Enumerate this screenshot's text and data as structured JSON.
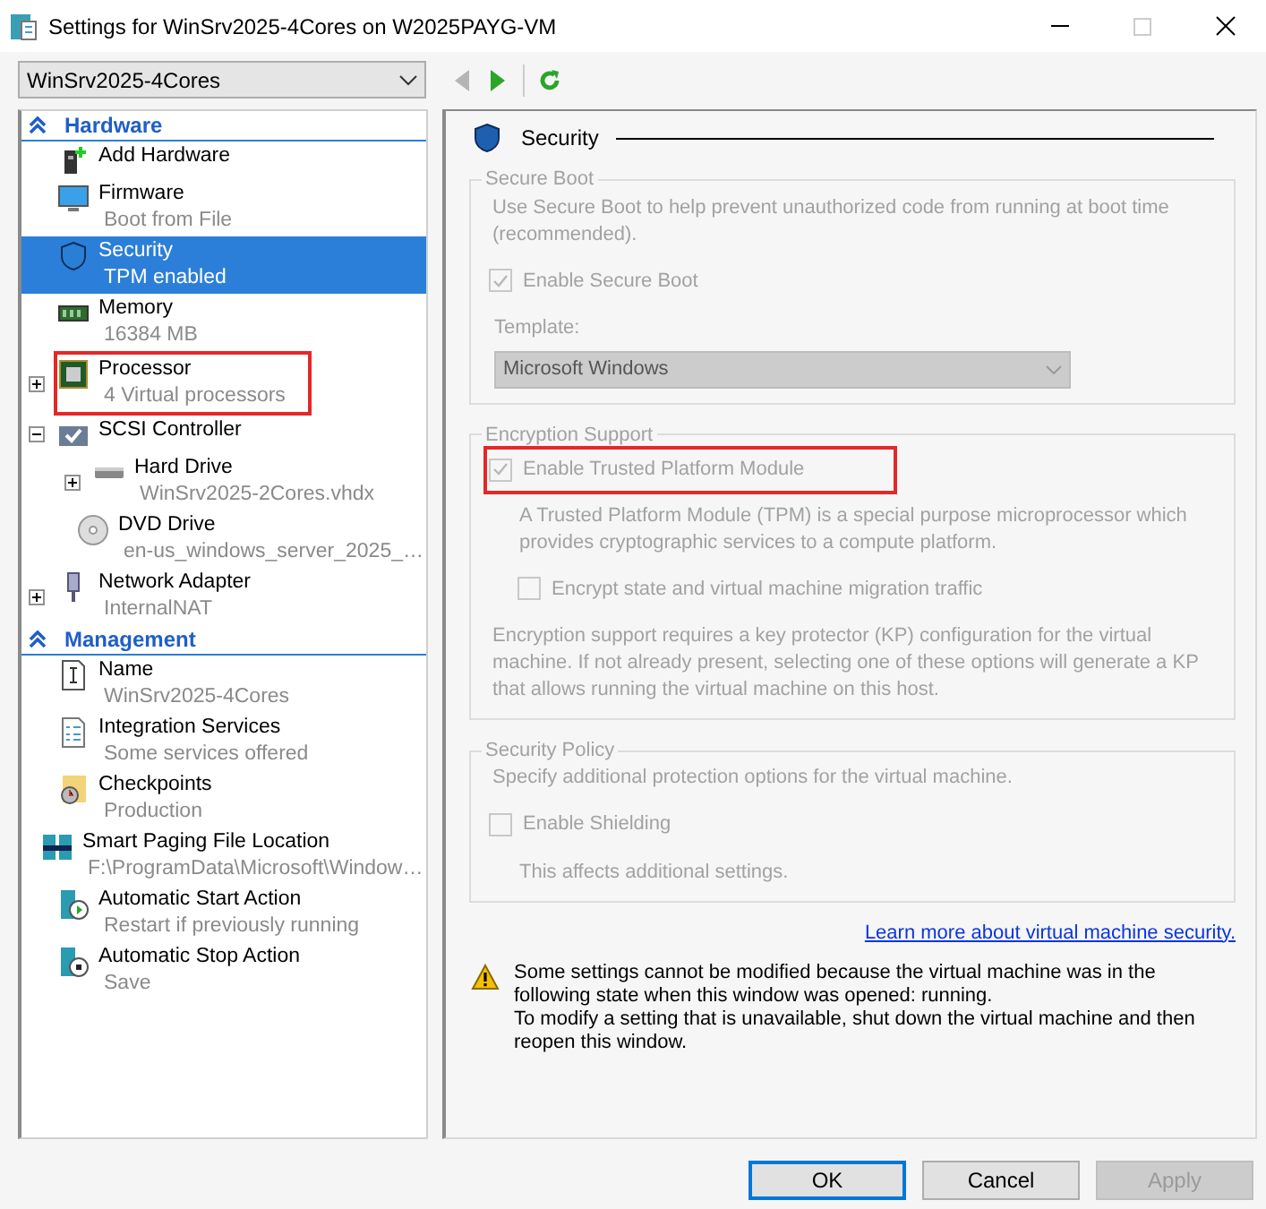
{
  "window": {
    "title": "Settings for WinSrv2025-4Cores on W2025PAYG-VM"
  },
  "vm_selector": {
    "value": "WinSrv2025-4Cores"
  },
  "toolbar": [
    {
      "kind": "back",
      "disabled": true
    },
    {
      "kind": "forward",
      "disabled": false
    },
    {
      "kind": "refresh",
      "disabled": false
    }
  ],
  "sidebar": {
    "sections": [
      {
        "title": "Hardware",
        "expanded": true,
        "items": [
          {
            "kind": "add-hardware",
            "name": "Add Hardware",
            "selected": false
          },
          {
            "kind": "firmware",
            "name": "Firmware",
            "detail": "Boot from File",
            "selected": false
          },
          {
            "kind": "security",
            "name": "Security",
            "detail": "TPM enabled",
            "selected": true
          },
          {
            "kind": "memory",
            "name": "Memory",
            "detail": "16384 MB",
            "selected": false
          },
          {
            "kind": "processor",
            "name": "Processor",
            "detail": "4 Virtual processors",
            "selected": false,
            "expanded": false,
            "highlighted": true
          },
          {
            "kind": "scsi",
            "name": "SCSI Controller",
            "selected": false,
            "expanded": true,
            "children": [
              {
                "kind": "hard-drive",
                "name": "Hard Drive",
                "detail": "WinSrv2025-2Cores.vhdx",
                "selected": false,
                "expanded": false
              },
              {
                "kind": "dvd",
                "name": "DVD Drive",
                "detail": "en-us_windows_server_2025_…",
                "selected": false
              }
            ]
          },
          {
            "kind": "network",
            "name": "Network Adapter",
            "detail": "InternalNAT",
            "selected": false,
            "expanded": false
          }
        ]
      },
      {
        "title": "Management",
        "expanded": true,
        "items": [
          {
            "kind": "name",
            "name": "Name",
            "detail": "WinSrv2025-4Cores",
            "selected": false
          },
          {
            "kind": "integration",
            "name": "Integration Services",
            "detail": "Some services offered",
            "selected": false
          },
          {
            "kind": "checkpoints",
            "name": "Checkpoints",
            "detail": "Production",
            "selected": false
          },
          {
            "kind": "paging",
            "name": "Smart Paging File Location",
            "detail": "F:\\ProgramData\\Microsoft\\Window…",
            "selected": false
          },
          {
            "kind": "start",
            "name": "Automatic Start Action",
            "detail": "Restart if previously running",
            "selected": false
          },
          {
            "kind": "stop",
            "name": "Automatic Stop Action",
            "detail": "Save",
            "selected": false
          }
        ]
      }
    ]
  },
  "panel": {
    "title": "Security",
    "groups": [
      {
        "legend": "Secure Boot",
        "disabled": true,
        "items": [
          {
            "kind": "text",
            "text": "Use Secure Boot to help prevent unauthorized code from running at boot time (recommended)."
          },
          {
            "kind": "checkbox",
            "label": "Enable Secure Boot",
            "checked": true
          },
          {
            "kind": "select",
            "label": "Template:",
            "value": "Microsoft Windows"
          }
        ]
      },
      {
        "legend": "Encryption Support",
        "disabled": true,
        "items": [
          {
            "kind": "checkbox",
            "label": "Enable Trusted Platform Module",
            "checked": true,
            "highlighted": true
          },
          {
            "kind": "note",
            "text": "A Trusted Platform Module (TPM) is a special purpose microprocessor which provides cryptographic services to a compute platform."
          },
          {
            "kind": "sub-checkbox",
            "label": "Encrypt state and virtual machine migration traffic",
            "checked": false
          },
          {
            "kind": "text",
            "text": "Encryption support requires a key protector (KP) configuration for the virtual machine. If not already present, selecting one of these options will generate a KP that allows running the virtual machine on this host."
          }
        ]
      },
      {
        "legend": "Security Policy",
        "disabled": true,
        "items": [
          {
            "kind": "text",
            "text": "Specify additional protection options for the virtual machine."
          },
          {
            "kind": "checkbox",
            "label": "Enable Shielding",
            "checked": false
          },
          {
            "kind": "note",
            "text": "This affects additional settings."
          }
        ]
      }
    ],
    "link": "Learn more about virtual machine security.",
    "warning": [
      "Some settings cannot be modified because the virtual machine was in the following state when this window was opened: running.",
      "To modify a setting that is unavailable, shut down the virtual machine and then reopen this window."
    ]
  },
  "buttons": [
    {
      "label": "OK",
      "kind": "default",
      "disabled": false
    },
    {
      "label": "Cancel",
      "kind": "normal",
      "disabled": false
    },
    {
      "label": "Apply",
      "kind": "normal",
      "disabled": true
    }
  ]
}
